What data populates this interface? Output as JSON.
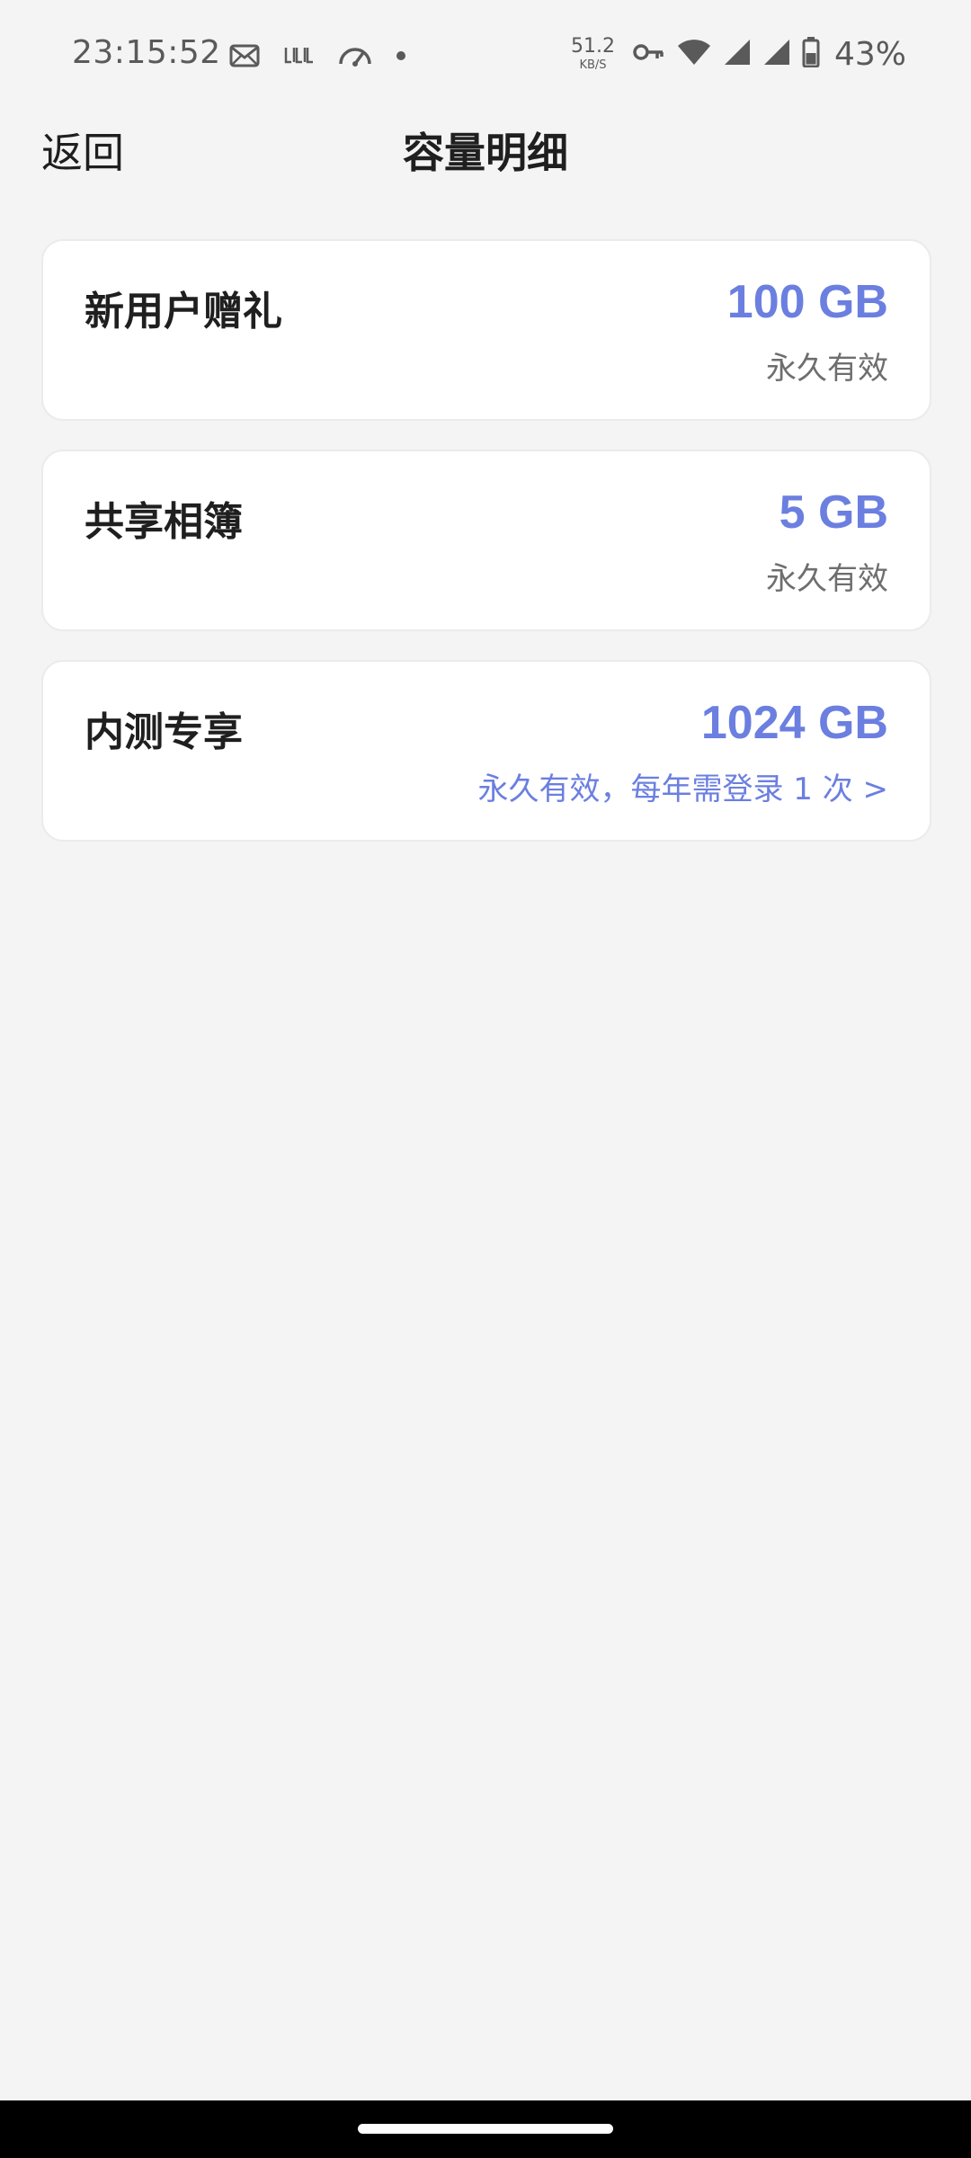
{
  "status_bar": {
    "time": "23:15:52",
    "net_speed_value": "51.2",
    "net_speed_unit": "KB/S",
    "battery_percent": "43%",
    "icons": [
      "mail-icon",
      "bilibili-icon",
      "speedometer-icon",
      "dot-icon",
      "vpn-key-icon",
      "wifi-icon",
      "signal-icon",
      "signal-icon",
      "battery-icon"
    ]
  },
  "header": {
    "back_label": "返回",
    "title": "容量明细"
  },
  "cards": [
    {
      "name": "新用户赠礼",
      "amount": "100 GB",
      "validity": "永久有效"
    },
    {
      "name": "共享相簿",
      "amount": "5 GB",
      "validity": "永久有效"
    },
    {
      "name": "内测专享",
      "amount": "1024 GB",
      "validity": "永久有效，每年需登录 1 次 >"
    }
  ],
  "colors": {
    "accent": "#6b7fe0",
    "background": "#f4f4f4",
    "card": "#ffffff",
    "primary_text": "#1f1f1f",
    "secondary_text": "#6e6e6e"
  }
}
